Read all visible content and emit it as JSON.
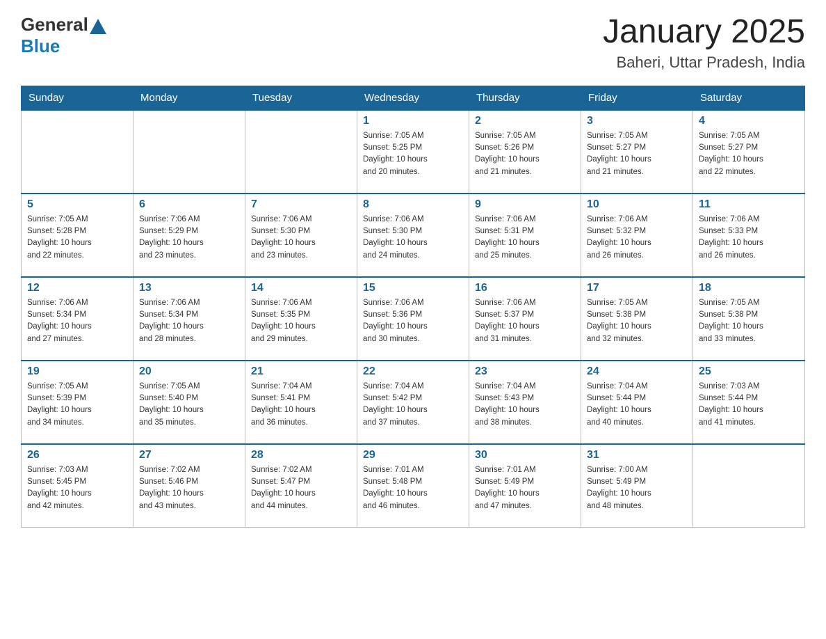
{
  "header": {
    "logo_general": "General",
    "logo_blue": "Blue",
    "title": "January 2025",
    "subtitle": "Baheri, Uttar Pradesh, India"
  },
  "weekdays": [
    "Sunday",
    "Monday",
    "Tuesday",
    "Wednesday",
    "Thursday",
    "Friday",
    "Saturday"
  ],
  "weeks": [
    [
      {
        "day": "",
        "info": ""
      },
      {
        "day": "",
        "info": ""
      },
      {
        "day": "",
        "info": ""
      },
      {
        "day": "1",
        "info": "Sunrise: 7:05 AM\nSunset: 5:25 PM\nDaylight: 10 hours\nand 20 minutes."
      },
      {
        "day": "2",
        "info": "Sunrise: 7:05 AM\nSunset: 5:26 PM\nDaylight: 10 hours\nand 21 minutes."
      },
      {
        "day": "3",
        "info": "Sunrise: 7:05 AM\nSunset: 5:27 PM\nDaylight: 10 hours\nand 21 minutes."
      },
      {
        "day": "4",
        "info": "Sunrise: 7:05 AM\nSunset: 5:27 PM\nDaylight: 10 hours\nand 22 minutes."
      }
    ],
    [
      {
        "day": "5",
        "info": "Sunrise: 7:05 AM\nSunset: 5:28 PM\nDaylight: 10 hours\nand 22 minutes."
      },
      {
        "day": "6",
        "info": "Sunrise: 7:06 AM\nSunset: 5:29 PM\nDaylight: 10 hours\nand 23 minutes."
      },
      {
        "day": "7",
        "info": "Sunrise: 7:06 AM\nSunset: 5:30 PM\nDaylight: 10 hours\nand 23 minutes."
      },
      {
        "day": "8",
        "info": "Sunrise: 7:06 AM\nSunset: 5:30 PM\nDaylight: 10 hours\nand 24 minutes."
      },
      {
        "day": "9",
        "info": "Sunrise: 7:06 AM\nSunset: 5:31 PM\nDaylight: 10 hours\nand 25 minutes."
      },
      {
        "day": "10",
        "info": "Sunrise: 7:06 AM\nSunset: 5:32 PM\nDaylight: 10 hours\nand 26 minutes."
      },
      {
        "day": "11",
        "info": "Sunrise: 7:06 AM\nSunset: 5:33 PM\nDaylight: 10 hours\nand 26 minutes."
      }
    ],
    [
      {
        "day": "12",
        "info": "Sunrise: 7:06 AM\nSunset: 5:34 PM\nDaylight: 10 hours\nand 27 minutes."
      },
      {
        "day": "13",
        "info": "Sunrise: 7:06 AM\nSunset: 5:34 PM\nDaylight: 10 hours\nand 28 minutes."
      },
      {
        "day": "14",
        "info": "Sunrise: 7:06 AM\nSunset: 5:35 PM\nDaylight: 10 hours\nand 29 minutes."
      },
      {
        "day": "15",
        "info": "Sunrise: 7:06 AM\nSunset: 5:36 PM\nDaylight: 10 hours\nand 30 minutes."
      },
      {
        "day": "16",
        "info": "Sunrise: 7:06 AM\nSunset: 5:37 PM\nDaylight: 10 hours\nand 31 minutes."
      },
      {
        "day": "17",
        "info": "Sunrise: 7:05 AM\nSunset: 5:38 PM\nDaylight: 10 hours\nand 32 minutes."
      },
      {
        "day": "18",
        "info": "Sunrise: 7:05 AM\nSunset: 5:38 PM\nDaylight: 10 hours\nand 33 minutes."
      }
    ],
    [
      {
        "day": "19",
        "info": "Sunrise: 7:05 AM\nSunset: 5:39 PM\nDaylight: 10 hours\nand 34 minutes."
      },
      {
        "day": "20",
        "info": "Sunrise: 7:05 AM\nSunset: 5:40 PM\nDaylight: 10 hours\nand 35 minutes."
      },
      {
        "day": "21",
        "info": "Sunrise: 7:04 AM\nSunset: 5:41 PM\nDaylight: 10 hours\nand 36 minutes."
      },
      {
        "day": "22",
        "info": "Sunrise: 7:04 AM\nSunset: 5:42 PM\nDaylight: 10 hours\nand 37 minutes."
      },
      {
        "day": "23",
        "info": "Sunrise: 7:04 AM\nSunset: 5:43 PM\nDaylight: 10 hours\nand 38 minutes."
      },
      {
        "day": "24",
        "info": "Sunrise: 7:04 AM\nSunset: 5:44 PM\nDaylight: 10 hours\nand 40 minutes."
      },
      {
        "day": "25",
        "info": "Sunrise: 7:03 AM\nSunset: 5:44 PM\nDaylight: 10 hours\nand 41 minutes."
      }
    ],
    [
      {
        "day": "26",
        "info": "Sunrise: 7:03 AM\nSunset: 5:45 PM\nDaylight: 10 hours\nand 42 minutes."
      },
      {
        "day": "27",
        "info": "Sunrise: 7:02 AM\nSunset: 5:46 PM\nDaylight: 10 hours\nand 43 minutes."
      },
      {
        "day": "28",
        "info": "Sunrise: 7:02 AM\nSunset: 5:47 PM\nDaylight: 10 hours\nand 44 minutes."
      },
      {
        "day": "29",
        "info": "Sunrise: 7:01 AM\nSunset: 5:48 PM\nDaylight: 10 hours\nand 46 minutes."
      },
      {
        "day": "30",
        "info": "Sunrise: 7:01 AM\nSunset: 5:49 PM\nDaylight: 10 hours\nand 47 minutes."
      },
      {
        "day": "31",
        "info": "Sunrise: 7:00 AM\nSunset: 5:49 PM\nDaylight: 10 hours\nand 48 minutes."
      },
      {
        "day": "",
        "info": ""
      }
    ]
  ]
}
